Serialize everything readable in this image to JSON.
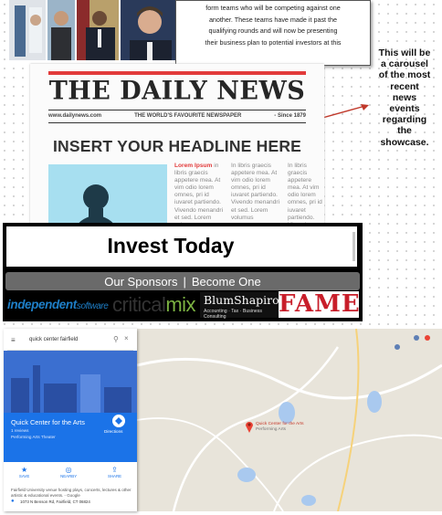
{
  "textbox": {
    "lines": [
      "form teams who will be competing against one",
      "another.  These teams have made it past the",
      "qualifying rounds and will now be presenting",
      "their business plan to potential investors at this"
    ]
  },
  "annotation": {
    "lines": [
      "This will be",
      "a carousel",
      "of the most",
      "recent",
      "news",
      "events",
      "regarding",
      "the",
      "showcase."
    ]
  },
  "newspaper": {
    "nameplate": "THE DAILY NEWS",
    "website": "www.dailynews.com",
    "tagline": "THE WORLD'S FAVOURITE NEWSPAPER",
    "since": "- Since 1879",
    "headline": "INSERT YOUR HEADLINE HERE",
    "col1": {
      "lead": "Lorem Ipsum",
      "rest": "in libris graecis appetere mea. At vim odio lorem omnes, pri id iuvaret partiendo. Vivendo menandri et sed. Lorem volumus"
    },
    "col2": {
      "text": "In libris graecis appetere mea. At vim odio lorem omnes, pri id iuvaret partiendo. Vivendo menandri et sed. Lorem volumus"
    },
    "col3": {
      "text": "In libris graecis appetere mea. At vim odio lorem omnes, pri id iuvaret partiendo. Vivendo menandri et sed. Lorem volumus"
    },
    "lower_col1": "At vim odio lorem omnes, pri id",
    "lower_col3": "partiendo. Vivendo"
  },
  "invest": {
    "title": "Invest Today",
    "sponsors_label": "Our Sponsors",
    "separator": "|",
    "become_label": "Become One"
  },
  "sponsors": {
    "independent": "independent",
    "independent_suffix": "software",
    "criticalmix_a": "critical",
    "criticalmix_b": "mix",
    "blum_name": "BlumShapiro",
    "blum_tag": "Accounting · Tax · Business Consulting",
    "fame": "FAME"
  },
  "map_card": {
    "search_text": "quick center fairfield",
    "place_name": "Quick Center for the Arts",
    "reviews": "1 reviews",
    "category": "Performing Arts Theater",
    "directions_label": "Directions",
    "actions": [
      "SAVE",
      "NEARBY",
      "SHARE"
    ],
    "description": "Fairfield University venue hosting plays, concerts, lectures & other artistic & educational events. - Google",
    "address": "1073 N Benson Rd, Fairfield, CT 06824"
  },
  "map": {
    "pin_label": "Quick Center for the Arts",
    "pin_sub": "Performing Arts"
  },
  "colors": {
    "accent_red": "#e23b3b",
    "maps_blue": "#1b73e8",
    "sponsor_bar": "#6a6a6a"
  }
}
